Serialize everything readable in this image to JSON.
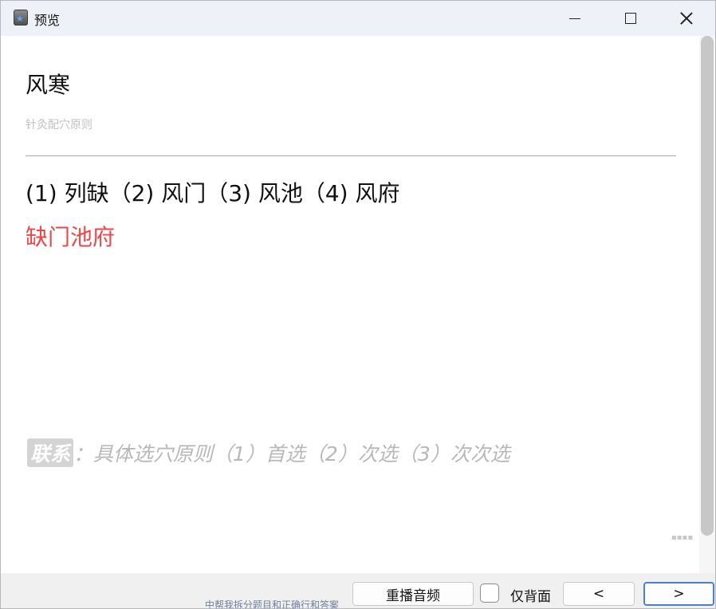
{
  "window": {
    "title": "预览",
    "controls": {
      "minimize": "minimize-icon",
      "maximize": "maximize-icon",
      "close": "close-icon"
    }
  },
  "card": {
    "title": "风寒",
    "subtitle": "针灸配穴原则",
    "question": "(1) 列缺（2) 风门（3) 风池（4) 风府",
    "answer": "缺门池府",
    "relation_tag": "联系",
    "relation_text": "：具体选穴原则（1）首选（2）次选（3）次次选"
  },
  "footer": {
    "behind_text": "中帮我拆分题目和正确行和答案",
    "replay_audio": "重播音频",
    "back_only": "仅背面",
    "prev": "<",
    "next": ">"
  },
  "colors": {
    "answer": "#ee4646",
    "muted": "#b8b8b8",
    "primary_border": "#4b7fd1"
  }
}
